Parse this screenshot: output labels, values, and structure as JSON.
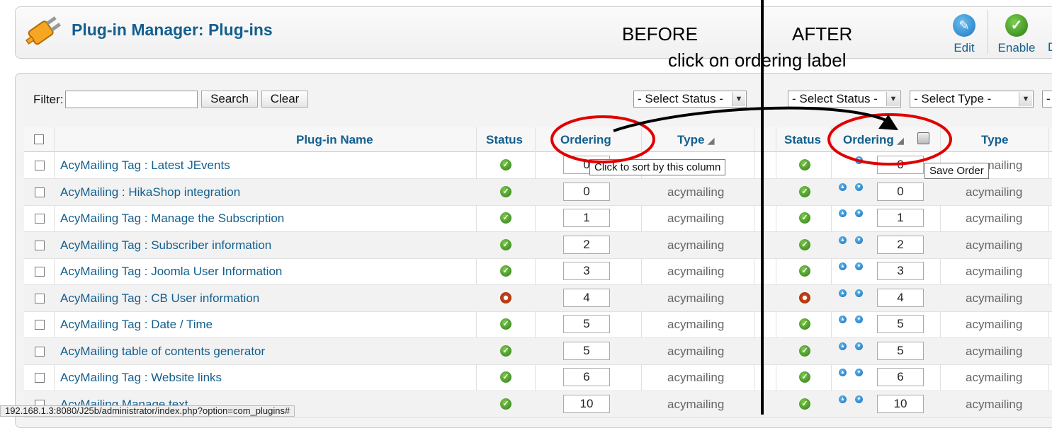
{
  "header": {
    "title": "Plug-in Manager: Plug-ins",
    "toolbar": {
      "edit": "Edit",
      "enable": "Enable",
      "partial": "D"
    }
  },
  "annotations": {
    "before": "BEFORE",
    "after": "AFTER",
    "instruction": "click on ordering label",
    "tooltip_sort": "Click to sort by this column",
    "tooltip_save": "Save Order"
  },
  "filter": {
    "label": "Filter:",
    "value": "",
    "search": "Search",
    "clear": "Clear",
    "status_before": "- Select Status -",
    "status_after": "- Select Status -",
    "type_after": "- Select Type -",
    "partial": "-"
  },
  "columns": {
    "name": "Plug-in Name",
    "status": "Status",
    "ordering": "Ordering",
    "type": "Type"
  },
  "rows": [
    {
      "name": "AcyMailing Tag : Latest JEvents",
      "enabled": true,
      "order": "0",
      "type": "acymailing"
    },
    {
      "name": "AcyMailing : HikaShop integration",
      "enabled": true,
      "order": "0",
      "type": "acymailing"
    },
    {
      "name": "AcyMailing Tag : Manage the Subscription",
      "enabled": true,
      "order": "1",
      "type": "acymailing"
    },
    {
      "name": "AcyMailing Tag : Subscriber information",
      "enabled": true,
      "order": "2",
      "type": "acymailing"
    },
    {
      "name": "AcyMailing Tag : Joomla User Information",
      "enabled": true,
      "order": "3",
      "type": "acymailing"
    },
    {
      "name": "AcyMailing Tag : CB User information",
      "enabled": false,
      "order": "4",
      "type": "acymailing"
    },
    {
      "name": "AcyMailing Tag : Date / Time",
      "enabled": true,
      "order": "5",
      "type": "acymailing"
    },
    {
      "name": "AcyMailing table of contents generator",
      "enabled": true,
      "order": "5",
      "type": "acymailing"
    },
    {
      "name": "AcyMailing Tag : Website links",
      "enabled": true,
      "order": "6",
      "type": "acymailing"
    },
    {
      "name": "AcyMailing Manage text",
      "enabled": true,
      "order": "10",
      "type": "acymailing"
    }
  ],
  "status_url": "192.168.1.3:8080/J25b/administrator/index.php?option=com_plugins#",
  "colors": {
    "brand": "#135f8e",
    "annotation": "#e00000"
  }
}
